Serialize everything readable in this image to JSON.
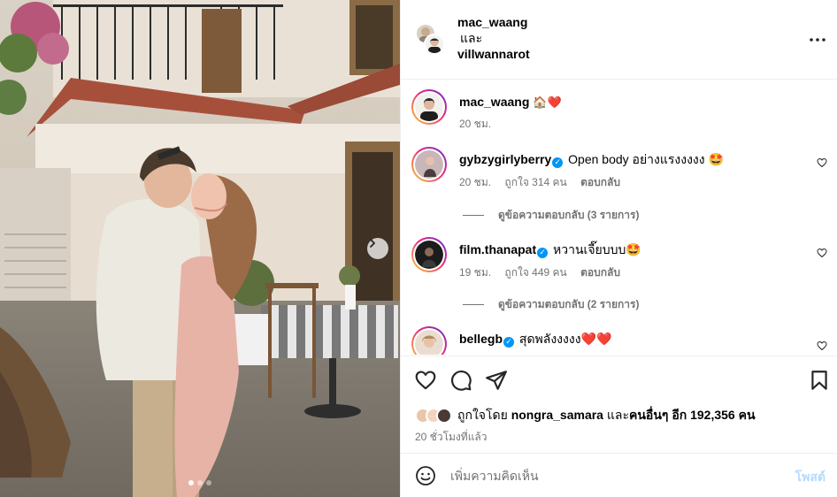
{
  "post": {
    "author_1": "mac_waang",
    "and": "และ",
    "author_2": "villwannarot",
    "more_icon": "more-horizontal-icon"
  },
  "caption": {
    "user": "mac_waang",
    "text": "🏠❤️",
    "time": "20 ชม."
  },
  "comments": [
    {
      "user": "gybzygirlyberry",
      "verified": true,
      "text": "Open body อย่างแรงงงงง 🤩",
      "time": "20 ชม.",
      "likes": "ถูกใจ 314 คน",
      "reply": "ตอบกลับ",
      "view_replies": "ดูข้อความตอบกลับ (3 รายการ)"
    },
    {
      "user": "film.thanapat",
      "verified": true,
      "text": "หวานเจี๊ยบบบ🤩",
      "time": "19 ชม.",
      "likes": "ถูกใจ 449 คน",
      "reply": "ตอบกลับ",
      "view_replies": "ดูข้อความตอบกลับ (2 รายการ)"
    },
    {
      "user": "bellegb",
      "verified": true,
      "text": "สุดพลังงงงง❤️❤️"
    }
  ],
  "likes": {
    "prefix": "ถูกใจโดย",
    "user": "nongra_samara",
    "suffix": "และ",
    "others": "คนอื่นๆ อีก 192,356 คน"
  },
  "time_ago": "20 ชั่วโมงที่แล้ว",
  "comment_input": {
    "placeholder": "เพิ่มความคิดเห็น",
    "post_label": "โพสต์"
  },
  "colors": {
    "verified": "#0095f6",
    "muted_text": "#737373",
    "heart_red": "#ed1c40",
    "post_disabled": "#b3dbff"
  },
  "carousel": {
    "slides": 3,
    "active": 1
  }
}
